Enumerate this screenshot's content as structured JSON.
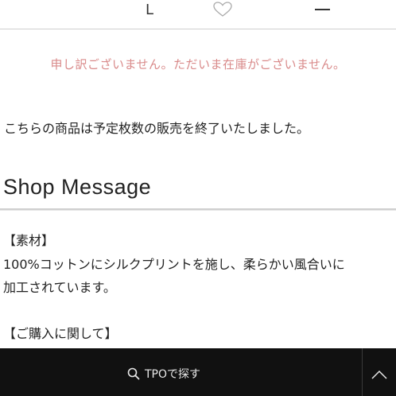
{
  "size_row": {
    "size_label": "L",
    "icons": {
      "favorite": "heart-icon",
      "quantity": "minus-icon"
    }
  },
  "stock_message": "申し訳ございません。ただいま在庫がございません。",
  "sale_ended_message": "こちらの商品は予定枚数の販売を終了いたしました。",
  "shop_message": {
    "title": "Shop Message",
    "lines": [
      "【素材】",
      "100%コットンにシルクプリントを施し、柔らかい風合いに",
      "加工されています。",
      "【ご購入に関して】"
    ]
  },
  "bottom_bar": {
    "search_label": "TPOで探す",
    "icons": {
      "search": "search-icon",
      "scroll_top": "chevron-up-icon"
    }
  },
  "colors": {
    "stock_message": "#d98a8a",
    "bottom_bar_bg": "#111111",
    "bottom_bar_text": "#e8e8e8"
  }
}
